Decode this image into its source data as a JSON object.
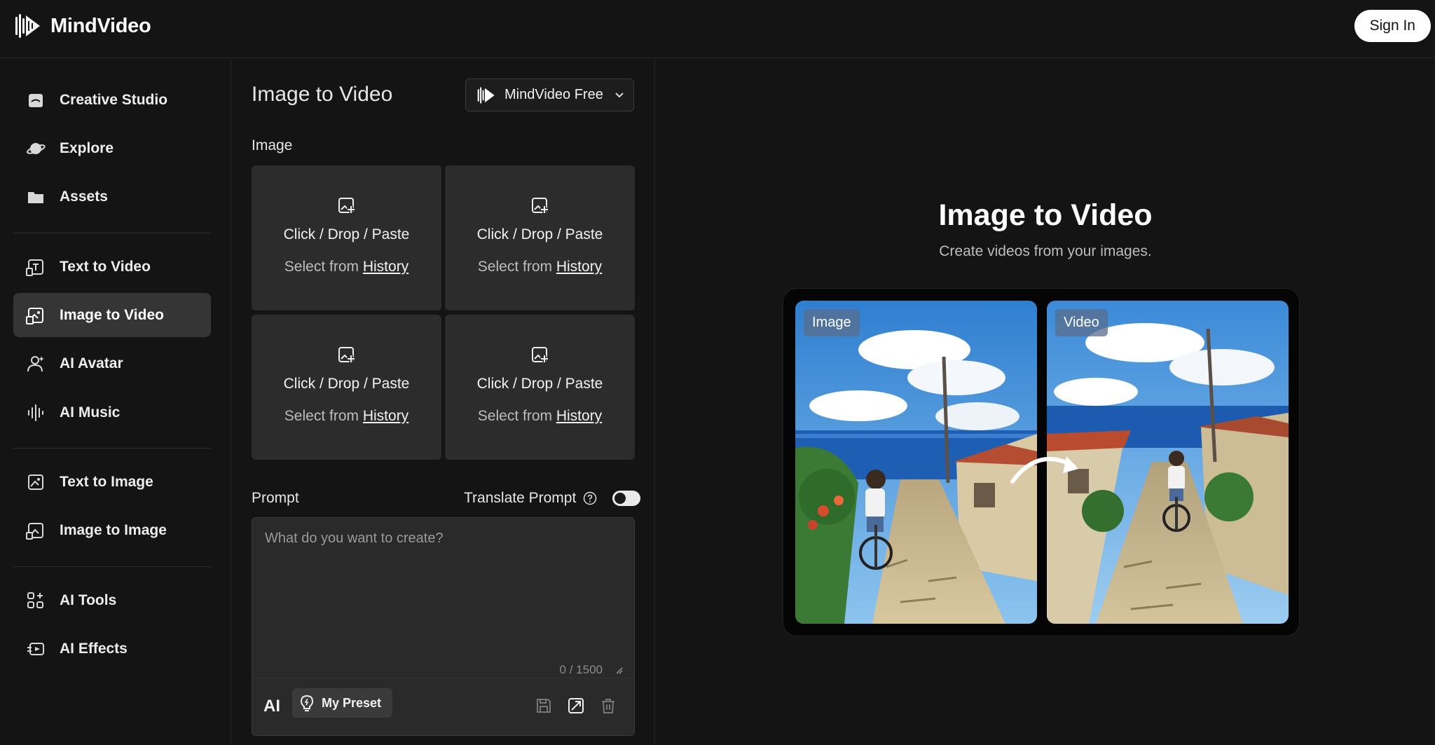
{
  "brand": {
    "name": "MindVideo"
  },
  "header": {
    "sign_in": "Sign In"
  },
  "sidebar": {
    "items": [
      {
        "label": "Creative Studio",
        "icon": "studio-icon"
      },
      {
        "label": "Explore",
        "icon": "planet-icon"
      },
      {
        "label": "Assets",
        "icon": "folder-icon"
      },
      {
        "label": "Text to Video",
        "icon": "text-video-icon"
      },
      {
        "label": "Image to Video",
        "icon": "image-video-icon",
        "active": true
      },
      {
        "label": "AI Avatar",
        "icon": "avatar-icon"
      },
      {
        "label": "AI Music",
        "icon": "waveform-icon"
      },
      {
        "label": "Text to Image",
        "icon": "text-image-icon"
      },
      {
        "label": "Image to Image",
        "icon": "image-image-icon"
      },
      {
        "label": "AI Tools",
        "icon": "tools-grid-icon"
      },
      {
        "label": "AI Effects",
        "icon": "effects-icon"
      }
    ]
  },
  "form": {
    "title": "Image to Video",
    "model": "MindVideo Free",
    "image_label": "Image",
    "upload_slots": [
      {
        "line1": "Click / Drop / Paste",
        "select_prefix": "Select from",
        "history_link": "History"
      },
      {
        "line1": "Click / Drop / Paste",
        "select_prefix": "Select from",
        "history_link": "History"
      },
      {
        "line1": "Click / Drop / Paste",
        "select_prefix": "Select from",
        "history_link": "History"
      },
      {
        "line1": "Click / Drop / Paste",
        "select_prefix": "Select from",
        "history_link": "History"
      }
    ],
    "prompt_label": "Prompt",
    "translate_label": "Translate Prompt",
    "translate_enabled": false,
    "prompt_placeholder": "What do you want to create?",
    "prompt_value": "",
    "char_counter": "0 / 1500",
    "ai_label": "AI",
    "preset_label": "My Preset"
  },
  "preview": {
    "title": "Image to Video",
    "subtitle": "Create videos from your images.",
    "left_tag": "Image",
    "right_tag": "Video"
  }
}
